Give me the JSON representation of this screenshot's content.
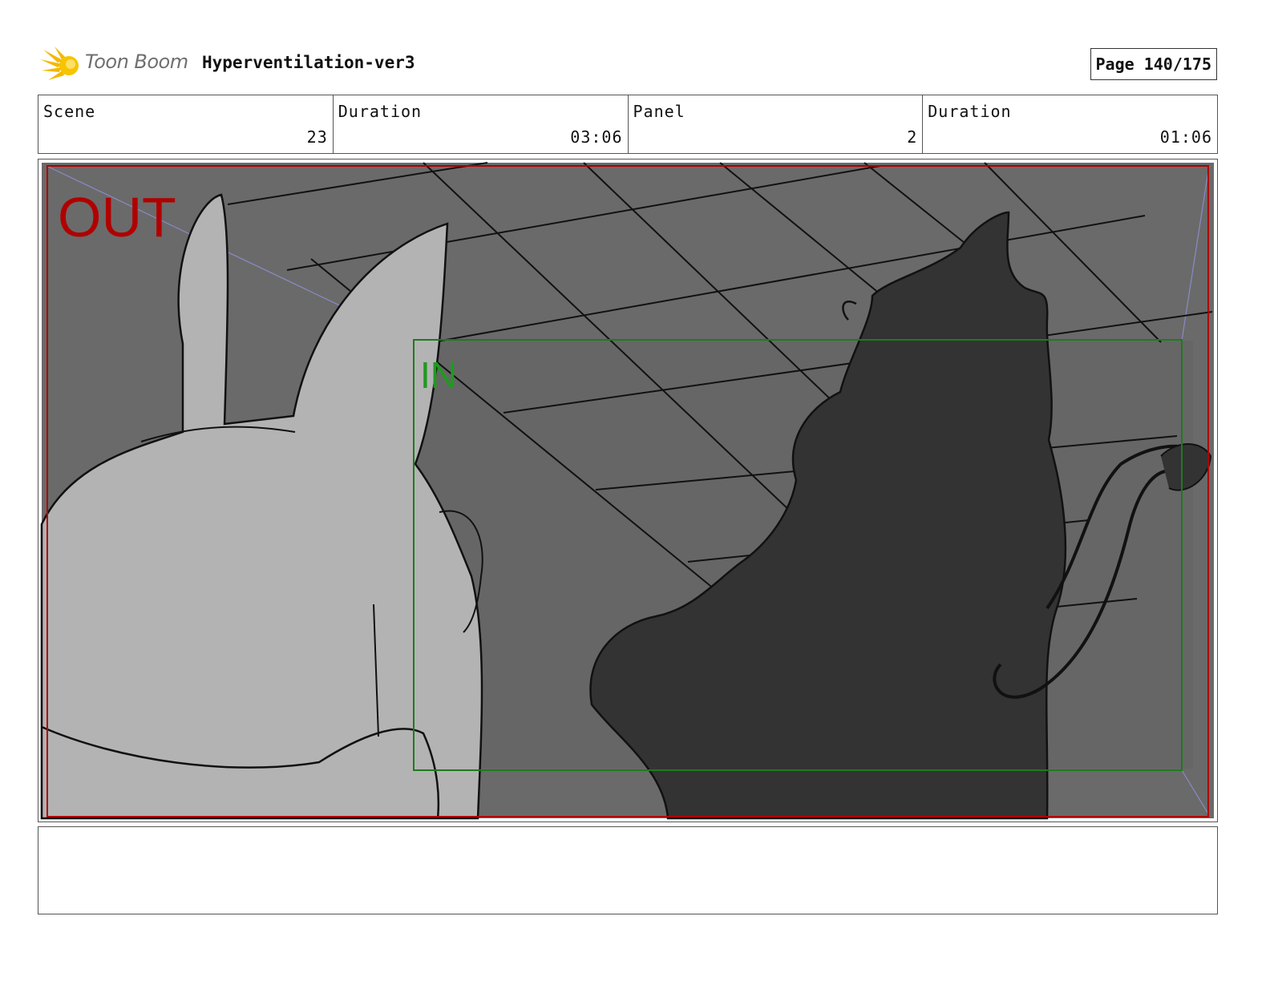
{
  "header": {
    "brand": "Toon Boom",
    "project_title": "Hyperventilation-ver3",
    "page": "Page 140/175"
  },
  "info": {
    "scene_label": "Scene",
    "scene_value": "23",
    "scene_duration_label": "Duration",
    "scene_duration_value": "03:06",
    "panel_label": "Panel",
    "panel_value": "2",
    "panel_duration_label": "Duration",
    "panel_duration_value": "01:06"
  },
  "frame": {
    "out_label": "OUT",
    "in_label": "IN"
  },
  "colors": {
    "out_frame": "#b00000",
    "in_frame": "#1f7a1f",
    "background": "#6a6a6a",
    "foreground_character": "#b3b3b3",
    "dark_character": "#333333",
    "guide_lines": "#8a8ac8"
  },
  "notes": ""
}
